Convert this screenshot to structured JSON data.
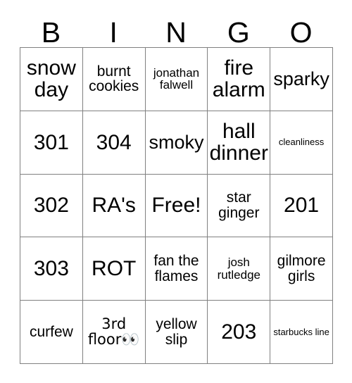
{
  "card": {
    "headers": [
      "B",
      "I",
      "N",
      "G",
      "O"
    ],
    "rows": [
      [
        {
          "text": "snow day",
          "size": "fs-xl"
        },
        {
          "text": "burnt cookies",
          "size": "fs-md"
        },
        {
          "text": "jonathan falwell",
          "size": "fs-sm"
        },
        {
          "text": "fire alarm",
          "size": "fs-xl"
        },
        {
          "text": "sparky",
          "size": "fs-lg"
        }
      ],
      [
        {
          "text": "301",
          "size": "fs-xl"
        },
        {
          "text": "304",
          "size": "fs-xl"
        },
        {
          "text": "smoky",
          "size": "fs-lg"
        },
        {
          "text": "hall dinner",
          "size": "fs-xl"
        },
        {
          "text": "cleanliness",
          "size": "fs-xs"
        }
      ],
      [
        {
          "text": "302",
          "size": "fs-xl"
        },
        {
          "text": "RA's",
          "size": "fs-xl"
        },
        {
          "text": "Free!",
          "size": "fs-xl"
        },
        {
          "text": "star ginger",
          "size": "fs-md"
        },
        {
          "text": "201",
          "size": "fs-xl"
        }
      ],
      [
        {
          "text": "303",
          "size": "fs-xl"
        },
        {
          "text": "ROT",
          "size": "fs-xl"
        },
        {
          "text": "fan the flames",
          "size": "fs-md"
        },
        {
          "text": "josh rutledge",
          "size": "fs-sm"
        },
        {
          "text": "gilmore girls",
          "size": "fs-md"
        }
      ],
      [
        {
          "text": "curfew",
          "size": "fs-md"
        },
        {
          "text": "3rd floor👀",
          "size": "fs-md"
        },
        {
          "text": "yellow slip",
          "size": "fs-md"
        },
        {
          "text": "203",
          "size": "fs-xl"
        },
        {
          "text": "starbucks line",
          "size": "fs-xs"
        }
      ]
    ],
    "free_space": {
      "row": 2,
      "col": 2,
      "label": "Free!"
    }
  },
  "colors": {
    "background": "#ffffff",
    "text": "#000000",
    "grid_line": "#808080"
  }
}
